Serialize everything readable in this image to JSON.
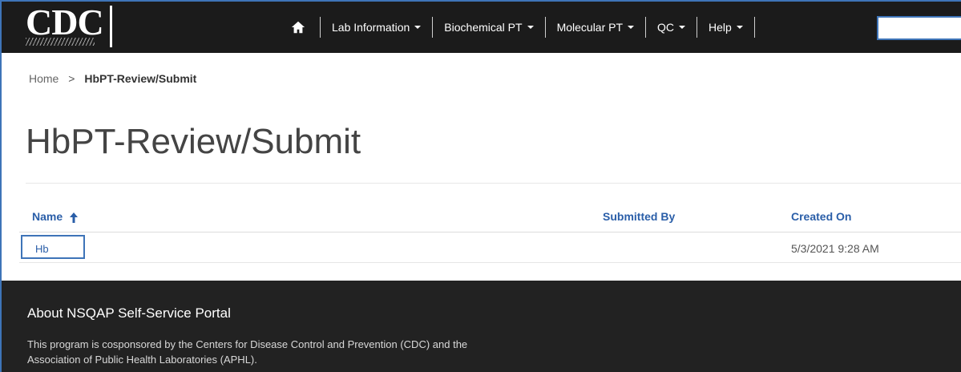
{
  "navbar": {
    "logo_text": "CDC",
    "items": [
      {
        "label": "Lab Information"
      },
      {
        "label": "Biochemical PT"
      },
      {
        "label": "Molecular PT"
      },
      {
        "label": "QC"
      },
      {
        "label": "Help"
      }
    ],
    "search_value": ""
  },
  "breadcrumb": {
    "home": "Home",
    "separator": ">",
    "current": "HbPT-Review/Submit"
  },
  "page": {
    "title": "HbPT-Review/Submit"
  },
  "table": {
    "columns": [
      "Name",
      "Submitted By",
      "Created On"
    ],
    "rows": [
      {
        "name": "Hb",
        "submitted_by": "",
        "created_on": "5/3/2021 9:28 AM"
      }
    ]
  },
  "footer": {
    "title": "About NSQAP Self-Service Portal",
    "text": "This program is cosponsored by the Centers for Disease Control and Prevention (CDC) and the Association of Public Health Laboratories (APHL)."
  },
  "colors": {
    "navbar_bg": "#1b1b1b",
    "link": "#2a5ea8",
    "highlight_border": "#3e74b8",
    "footer_bg": "#222222"
  }
}
